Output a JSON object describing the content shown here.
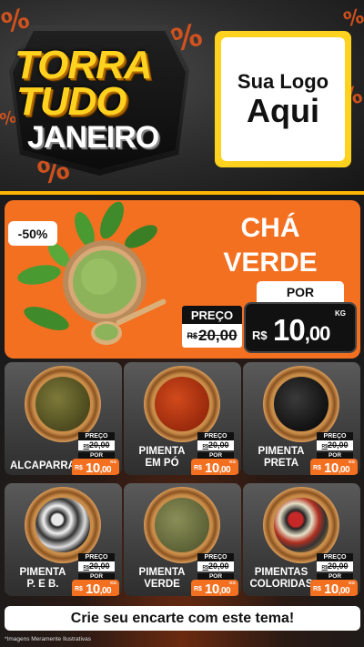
{
  "header": {
    "title_line1": "TORRA",
    "title_line2": "TUDO",
    "title_line3": "JANEIRO",
    "logo_line1": "Sua Logo",
    "logo_line2": "Aqui",
    "percent_symbol": "%"
  },
  "featured": {
    "discount": "-50%",
    "name_line1": "CHÁ",
    "name_line2": "VERDE",
    "por_label": "POR",
    "preco_label": "PREÇO",
    "old_currency": "R$",
    "old_value": "20,00",
    "new_currency": "R$",
    "new_int": "10",
    "new_cents": ",00",
    "unit": "KG"
  },
  "products": [
    {
      "name": "ALCAPARRAS",
      "preco_label": "PREÇO",
      "old_currency": "R$",
      "old_value": "20,00",
      "por_label": "POR",
      "new_currency": "R$",
      "new_int": "10",
      "new_cents": ",00",
      "unit": "KG"
    },
    {
      "name": "PIMENTA EM PÓ",
      "preco_label": "PREÇO",
      "old_currency": "R$",
      "old_value": "20,00",
      "por_label": "POR",
      "new_currency": "R$",
      "new_int": "10",
      "new_cents": ",00",
      "unit": "KG"
    },
    {
      "name": "PIMENTA PRETA",
      "preco_label": "PREÇO",
      "old_currency": "R$",
      "old_value": "20,00",
      "por_label": "POR",
      "new_currency": "R$",
      "new_int": "10",
      "new_cents": ",00",
      "unit": "KG"
    },
    {
      "name": "PIMENTA P. E B.",
      "preco_label": "PREÇO",
      "old_currency": "R$",
      "old_value": "20,00",
      "por_label": "POR",
      "new_currency": "R$",
      "new_int": "10",
      "new_cents": ",00",
      "unit": "KG"
    },
    {
      "name": "PIMENTA VERDE",
      "preco_label": "PREÇO",
      "old_currency": "R$",
      "old_value": "20,00",
      "por_label": "POR",
      "new_currency": "R$",
      "new_int": "10",
      "new_cents": ",00",
      "unit": "KG"
    },
    {
      "name": "PIMENTAS COLORIDAS",
      "preco_label": "PREÇO",
      "old_currency": "R$",
      "old_value": "20,00",
      "por_label": "POR",
      "new_currency": "R$",
      "new_int": "10",
      "new_cents": ",00",
      "unit": "KG"
    }
  ],
  "footer": {
    "cta": "Crie seu encarte com este tema!",
    "disclaimer": "*Imagens Meramente Ilustrativas"
  },
  "colors": {
    "accent_orange": "#f37021",
    "title_yellow": "#ffd21f",
    "dark": "#111111"
  }
}
